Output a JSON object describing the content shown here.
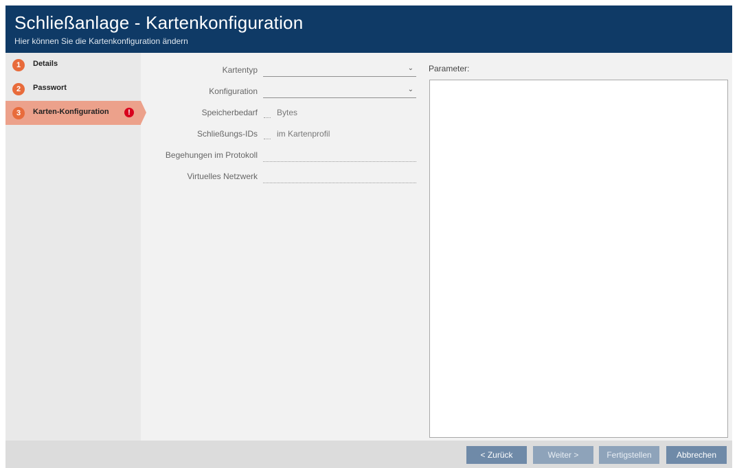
{
  "header": {
    "title": "Schließanlage - Kartenkonfiguration",
    "subtitle": "Hier können Sie die Kartenkonfiguration ändern"
  },
  "steps": [
    {
      "number": "1",
      "label": "Details"
    },
    {
      "number": "2",
      "label": "Passwort"
    },
    {
      "number": "3",
      "label": "Karten-Konfiguration",
      "error_icon": "!"
    }
  ],
  "form": {
    "kartentyp_label": "Kartentyp",
    "kartentyp_value": "",
    "konfiguration_label": "Konfiguration",
    "konfiguration_value": "",
    "speicherbedarf_label": "Speicherbedarf",
    "speicherbedarf_unit": "Bytes",
    "schliessungs_ids_label": "Schließungs-IDs",
    "schliessungs_ids_unit": "im Kartenprofil",
    "begehungen_label": "Begehungen im Protokoll",
    "begehungen_value": "",
    "virtuelles_netzwerk_label": "Virtuelles Netzwerk",
    "virtuelles_netzwerk_value": ""
  },
  "parameter": {
    "label": "Parameter:",
    "value": ""
  },
  "footer": {
    "back_label": "< Zurück",
    "next_label": "Weiter >",
    "finish_label": "Fertigstellen",
    "cancel_label": "Abbrechen"
  },
  "colors": {
    "header_bg": "#0f3a66",
    "step_number": "#e86b3b",
    "active_step_bg": "#eca18b",
    "error": "#d8001c",
    "button": "#6f8aa8"
  }
}
